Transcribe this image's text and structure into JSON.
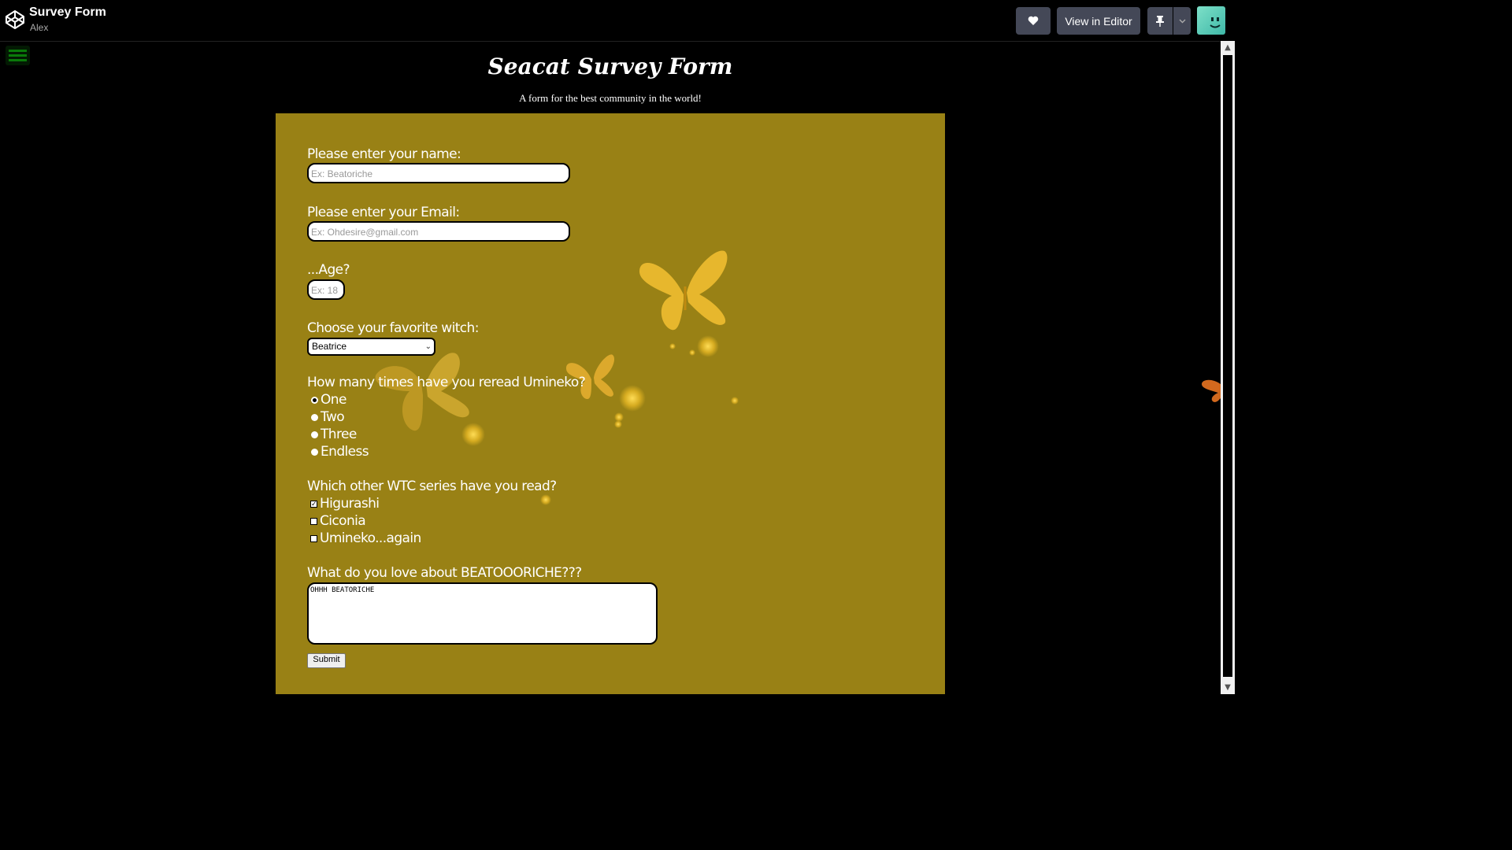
{
  "header": {
    "project_title": "Survey Form",
    "author": "Alex",
    "view_in_editor": "View in Editor",
    "icons": [
      "codepen-logo-icon",
      "heart-icon",
      "pin-icon",
      "chevron-down-icon"
    ]
  },
  "page": {
    "title": "Seacat Survey Form",
    "subtitle": "A form for the best community in the world!"
  },
  "form": {
    "name_label": "Please enter your name:",
    "name_placeholder": "Ex: Beatoriche",
    "email_label": "Please enter your Email:",
    "email_placeholder": "Ex: Ohdesire@gmail.com",
    "age_label": "...Age?",
    "age_placeholder": "Ex: 18",
    "witch_label": "Choose your favorite witch:",
    "witch_selected": "Beatrice",
    "reread_label": "How many times have you reread Umineko?",
    "reread_options": [
      "One",
      "Two",
      "Three",
      "Endless"
    ],
    "reread_selected": "One",
    "series_label": "Which other WTC series have you read?",
    "series_options": [
      "Higurashi",
      "Ciconia",
      "Umineko...again"
    ],
    "series_checked": [
      "Higurashi"
    ],
    "love_label": "What do you love about BEATOOORICHE???",
    "love_value": "OHHH BEATORICHE",
    "submit_label": "Submit"
  },
  "colors": {
    "panel_bg": "#998115",
    "page_bg": "#000000",
    "button_bg": "#444857"
  }
}
